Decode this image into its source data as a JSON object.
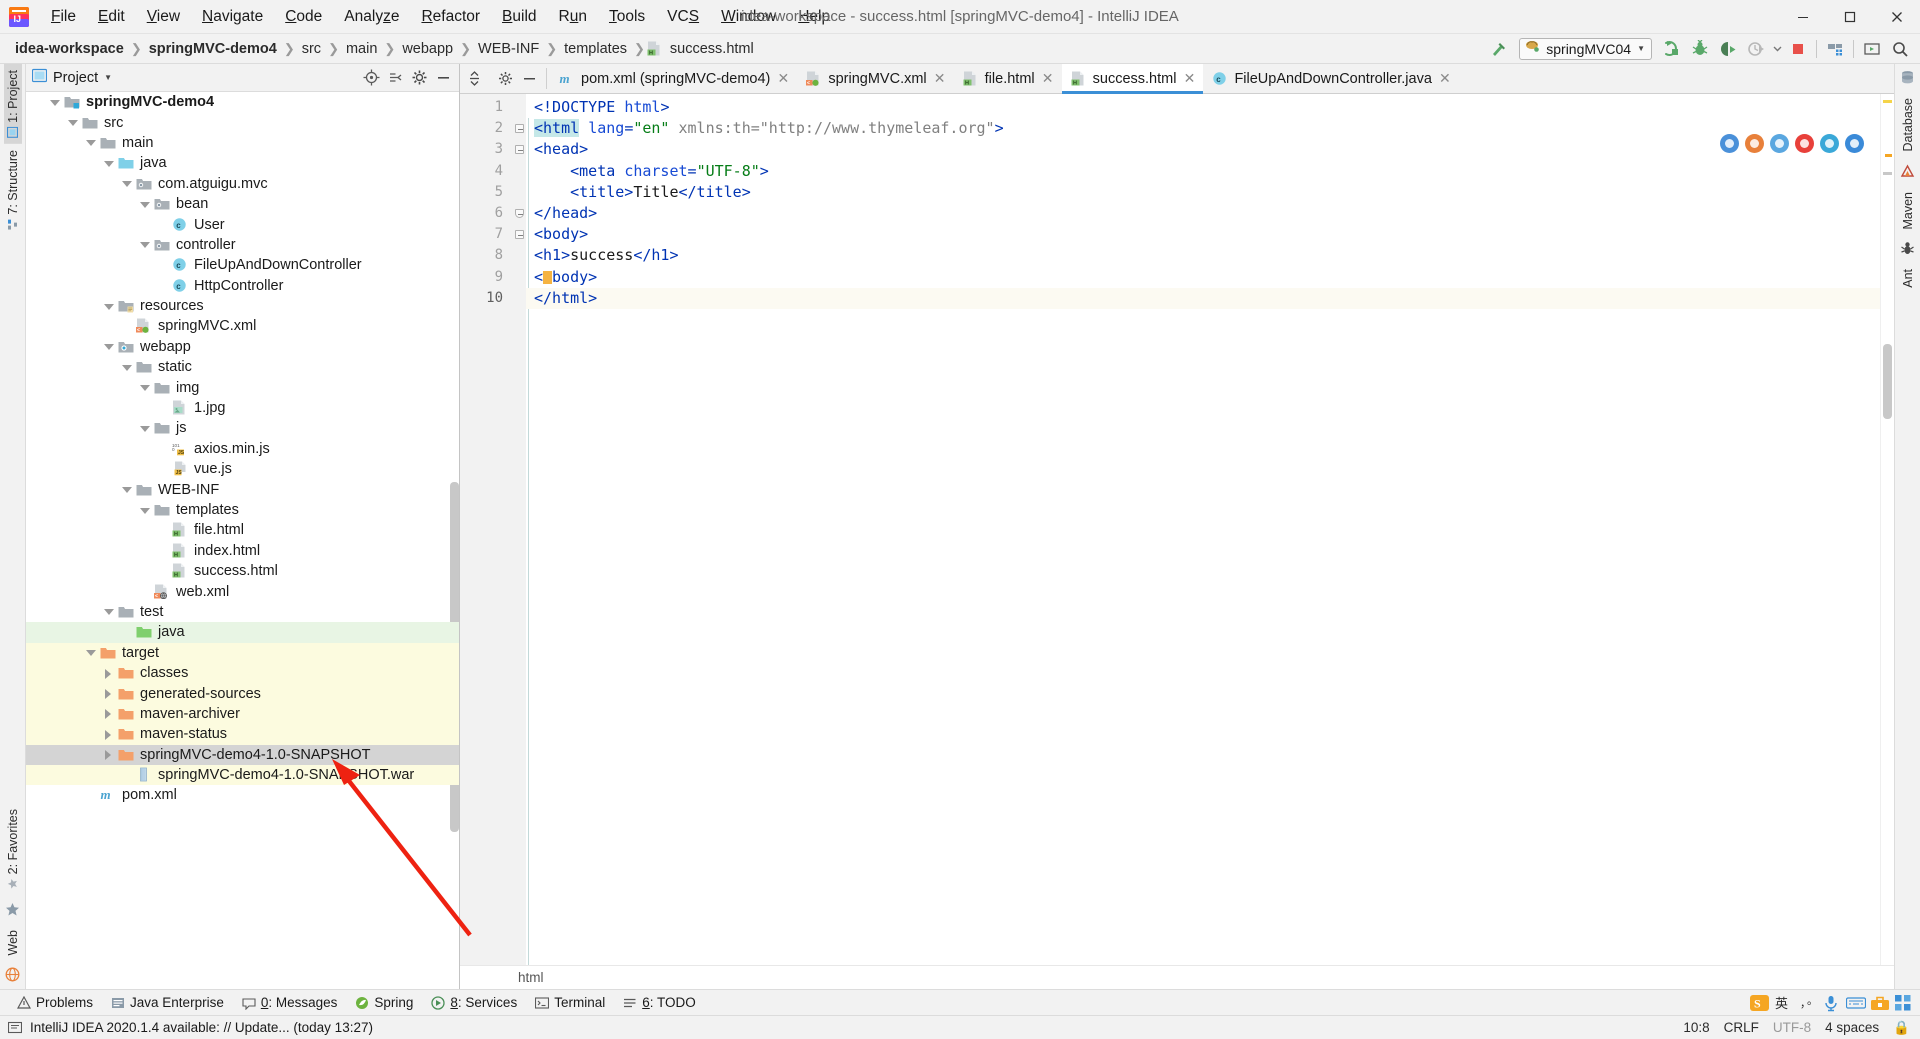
{
  "window": {
    "title": "idea-workspace - success.html [springMVC-demo4] - IntelliJ IDEA",
    "app_icon": "intellij-idea-logo",
    "minimize": "—",
    "maximize": "❐",
    "close": "✕"
  },
  "menubar": [
    {
      "label": "File",
      "mnemonic": "F"
    },
    {
      "label": "Edit",
      "mnemonic": "E"
    },
    {
      "label": "View",
      "mnemonic": "V"
    },
    {
      "label": "Navigate",
      "mnemonic": "N"
    },
    {
      "label": "Code",
      "mnemonic": "C"
    },
    {
      "label": "Analyze",
      "mnemonic": "z"
    },
    {
      "label": "Refactor",
      "mnemonic": "R"
    },
    {
      "label": "Build",
      "mnemonic": "B"
    },
    {
      "label": "Run",
      "mnemonic": "u"
    },
    {
      "label": "Tools",
      "mnemonic": "T"
    },
    {
      "label": "VCS",
      "mnemonic": "S"
    },
    {
      "label": "Window",
      "mnemonic": "W"
    },
    {
      "label": "Help",
      "mnemonic": "H"
    }
  ],
  "breadcrumb": {
    "items": [
      {
        "label": "idea-workspace",
        "bold": true,
        "icon": ""
      },
      {
        "label": "springMVC-demo4",
        "bold": true,
        "icon": ""
      },
      {
        "label": "src",
        "bold": false,
        "icon": ""
      },
      {
        "label": "main",
        "bold": false,
        "icon": ""
      },
      {
        "label": "webapp",
        "bold": false,
        "icon": ""
      },
      {
        "label": "WEB-INF",
        "bold": false,
        "icon": ""
      },
      {
        "label": "templates",
        "bold": false,
        "icon": ""
      },
      {
        "label": "success.html",
        "bold": false,
        "icon": "html-file-icon"
      }
    ],
    "separator": "❯"
  },
  "main_toolbar": {
    "hammer_icon": "build-hammer-icon",
    "run_config": {
      "label": "springMVC04",
      "icon": "tomcat-icon",
      "chevron": "▼"
    },
    "actions": [
      {
        "name": "run-button",
        "icon": "run-icon",
        "color": "#3cab3c"
      },
      {
        "name": "debug-button",
        "icon": "debug-bug-icon",
        "color": "#3cab3c"
      },
      {
        "name": "run-coverage-button",
        "icon": "run-coverage-icon",
        "color": "#3a8a3a"
      },
      {
        "name": "profiler-button",
        "icon": "profiler-icon",
        "color": "#b8b8b8"
      },
      {
        "name": "stop-button",
        "icon": "stop-square-icon",
        "color": "#e8504a"
      },
      {
        "name": "project-structure-button",
        "icon": "project-structure-icon",
        "color": "#3b8fd6"
      },
      {
        "name": "updates-button",
        "icon": "screen-icon",
        "color": "#3cab3c"
      },
      {
        "name": "search-everywhere-button",
        "icon": "search-icon",
        "color": "#4a4a4a"
      }
    ]
  },
  "left_rail": [
    {
      "label": "1: Project",
      "active": true,
      "icon": "project-icon"
    },
    {
      "label": "7: Structure",
      "active": false,
      "icon": "structure-icon"
    },
    {
      "label": "2: Favorites",
      "active": false,
      "icon": "favorites-star-icon"
    },
    {
      "label": "Web",
      "active": false,
      "icon": "web-icon"
    }
  ],
  "right_rail": [
    {
      "label": "Database",
      "icon": "database-icon"
    },
    {
      "label": "Maven",
      "icon": "maven-icon"
    },
    {
      "label": "Ant",
      "icon": "ant-icon"
    }
  ],
  "project_panel": {
    "title": "Project",
    "chevron": "▼",
    "icon": "project-window-icon",
    "header_actions": [
      {
        "name": "scroll-from-source-button",
        "icon": "target-crosshair-icon"
      },
      {
        "name": "collapse-all-button",
        "icon": "collapse-all-icon"
      },
      {
        "name": "settings-button",
        "icon": "gear-icon"
      },
      {
        "name": "hide-button",
        "icon": "minimize-icon"
      }
    ],
    "tree": [
      {
        "label": "springMVC-demo4",
        "depth": 0,
        "arrow": "down",
        "icon": "module-folder",
        "bold": true,
        "bg": ""
      },
      {
        "label": "src",
        "depth": 1,
        "arrow": "down",
        "icon": "folder-gray",
        "bold": false,
        "bg": ""
      },
      {
        "label": "main",
        "depth": 2,
        "arrow": "down",
        "icon": "folder-gray",
        "bold": false,
        "bg": ""
      },
      {
        "label": "java",
        "depth": 3,
        "arrow": "down",
        "icon": "folder-blue-src",
        "bold": false,
        "bg": ""
      },
      {
        "label": "com.atguigu.mvc",
        "depth": 4,
        "arrow": "down",
        "icon": "package",
        "bold": false,
        "bg": ""
      },
      {
        "label": "bean",
        "depth": 5,
        "arrow": "down",
        "icon": "package",
        "bold": false,
        "bg": ""
      },
      {
        "label": "User",
        "depth": 6,
        "arrow": "none",
        "icon": "java-class",
        "bold": false,
        "bg": ""
      },
      {
        "label": "controller",
        "depth": 5,
        "arrow": "down",
        "icon": "package",
        "bold": false,
        "bg": ""
      },
      {
        "label": "FileUpAndDownController",
        "depth": 6,
        "arrow": "none",
        "icon": "java-class",
        "bold": false,
        "bg": ""
      },
      {
        "label": "HttpController",
        "depth": 6,
        "arrow": "none",
        "icon": "java-class",
        "bold": false,
        "bg": ""
      },
      {
        "label": "resources",
        "depth": 3,
        "arrow": "down",
        "icon": "folder-resources",
        "bold": false,
        "bg": ""
      },
      {
        "label": "springMVC.xml",
        "depth": 4,
        "arrow": "none",
        "icon": "spring-xml",
        "bold": false,
        "bg": ""
      },
      {
        "label": "webapp",
        "depth": 3,
        "arrow": "down",
        "icon": "folder-webapp",
        "bold": false,
        "bg": ""
      },
      {
        "label": "static",
        "depth": 4,
        "arrow": "down",
        "icon": "folder-gray",
        "bold": false,
        "bg": ""
      },
      {
        "label": "img",
        "depth": 5,
        "arrow": "down",
        "icon": "folder-gray",
        "bold": false,
        "bg": ""
      },
      {
        "label": "1.jpg",
        "depth": 6,
        "arrow": "none",
        "icon": "image-file",
        "bold": false,
        "bg": ""
      },
      {
        "label": "js",
        "depth": 5,
        "arrow": "down",
        "icon": "folder-gray",
        "bold": false,
        "bg": ""
      },
      {
        "label": "axios.min.js",
        "depth": 6,
        "arrow": "none",
        "icon": "js-min-file",
        "bold": false,
        "bg": ""
      },
      {
        "label": "vue.js",
        "depth": 6,
        "arrow": "none",
        "icon": "js-file",
        "bold": false,
        "bg": ""
      },
      {
        "label": "WEB-INF",
        "depth": 4,
        "arrow": "down",
        "icon": "folder-gray",
        "bold": false,
        "bg": ""
      },
      {
        "label": "templates",
        "depth": 5,
        "arrow": "down",
        "icon": "folder-gray",
        "bold": false,
        "bg": ""
      },
      {
        "label": "file.html",
        "depth": 6,
        "arrow": "none",
        "icon": "html-file",
        "bold": false,
        "bg": ""
      },
      {
        "label": "index.html",
        "depth": 6,
        "arrow": "none",
        "icon": "html-file",
        "bold": false,
        "bg": ""
      },
      {
        "label": "success.html",
        "depth": 6,
        "arrow": "none",
        "icon": "html-file",
        "bold": false,
        "bg": ""
      },
      {
        "label": "web.xml",
        "depth": 5,
        "arrow": "none",
        "icon": "web-xml",
        "bold": false,
        "bg": ""
      },
      {
        "label": "test",
        "depth": 3,
        "arrow": "down",
        "icon": "folder-gray",
        "bold": false,
        "bg": ""
      },
      {
        "label": "java",
        "depth": 4,
        "arrow": "none",
        "icon": "folder-green-test",
        "bold": false,
        "bg": "green"
      },
      {
        "label": "target",
        "depth": 2,
        "arrow": "down",
        "icon": "folder-orange",
        "bold": false,
        "bg": "yellow"
      },
      {
        "label": "classes",
        "depth": 3,
        "arrow": "right",
        "icon": "folder-orange",
        "bold": false,
        "bg": "yellow"
      },
      {
        "label": "generated-sources",
        "depth": 3,
        "arrow": "right",
        "icon": "folder-orange",
        "bold": false,
        "bg": "yellow"
      },
      {
        "label": "maven-archiver",
        "depth": 3,
        "arrow": "right",
        "icon": "folder-orange",
        "bold": false,
        "bg": "yellow"
      },
      {
        "label": "maven-status",
        "depth": 3,
        "arrow": "right",
        "icon": "folder-orange",
        "bold": false,
        "bg": "yellow"
      },
      {
        "label": "springMVC-demo4-1.0-SNAPSHOT",
        "depth": 3,
        "arrow": "right",
        "icon": "folder-orange",
        "bold": false,
        "bg": "sel"
      },
      {
        "label": "springMVC-demo4-1.0-SNAPSHOT.war",
        "depth": 4,
        "arrow": "none",
        "icon": "war-file",
        "bold": false,
        "bg": "yellow"
      },
      {
        "label": "pom.xml",
        "depth": 2,
        "arrow": "none",
        "icon": "maven-pom",
        "bold": false,
        "bg": ""
      }
    ]
  },
  "editor": {
    "tabstrip_actions": [
      {
        "name": "expand-collapse-button",
        "icon": "vertical-arrows-icon"
      },
      {
        "name": "settings-button",
        "icon": "gear-icon"
      },
      {
        "name": "hide-button",
        "icon": "minimize-icon"
      }
    ],
    "tabs": [
      {
        "label": "pom.xml (springMVC-demo4)",
        "icon": "maven-pom",
        "active": false,
        "close": "✕"
      },
      {
        "label": "springMVC.xml",
        "icon": "spring-xml",
        "active": false,
        "close": "✕"
      },
      {
        "label": "file.html",
        "icon": "html-file",
        "active": false,
        "close": "✕"
      },
      {
        "label": "success.html",
        "icon": "html-file",
        "active": true,
        "close": "✕"
      },
      {
        "label": "FileUpAndDownController.java",
        "icon": "java-class",
        "active": false,
        "close": "✕"
      }
    ],
    "line_numbers": [
      "1",
      "2",
      "3",
      "4",
      "5",
      "6",
      "7",
      "8",
      "9",
      "10"
    ],
    "current_line": 10,
    "lines": [
      {
        "n": 1,
        "tokens": [
          {
            "t": "<!DOCTYPE ",
            "c": "tag"
          },
          {
            "t": "html",
            "c": "attr"
          },
          {
            "t": ">",
            "c": "tag"
          }
        ]
      },
      {
        "n": 2,
        "tokens": [
          {
            "t": "<html",
            "c": "tag-hl"
          },
          {
            "t": " ",
            "c": "txt"
          },
          {
            "t": "lang",
            "c": "attr"
          },
          {
            "t": "=",
            "c": "tag"
          },
          {
            "t": "\"en\"",
            "c": "str"
          },
          {
            "t": " ",
            "c": "txt"
          },
          {
            "t": "xmlns:th",
            "c": "gray"
          },
          {
            "t": "=",
            "c": "gray"
          },
          {
            "t": "\"http://www.thymeleaf.org\"",
            "c": "gray"
          },
          {
            "t": ">",
            "c": "tag"
          }
        ]
      },
      {
        "n": 3,
        "tokens": [
          {
            "t": "<head>",
            "c": "tag"
          }
        ]
      },
      {
        "n": 4,
        "tokens": [
          {
            "t": "    <meta ",
            "c": "tag"
          },
          {
            "t": "charset",
            "c": "attr"
          },
          {
            "t": "=",
            "c": "tag"
          },
          {
            "t": "\"UTF-8\"",
            "c": "str"
          },
          {
            "t": ">",
            "c": "tag"
          }
        ]
      },
      {
        "n": 5,
        "tokens": [
          {
            "t": "    <title>",
            "c": "tag"
          },
          {
            "t": "Title",
            "c": "txt"
          },
          {
            "t": "</title>",
            "c": "tag"
          }
        ]
      },
      {
        "n": 6,
        "tokens": [
          {
            "t": "</head>",
            "c": "tag"
          }
        ]
      },
      {
        "n": 7,
        "tokens": [
          {
            "t": "<body>",
            "c": "tag"
          }
        ]
      },
      {
        "n": 8,
        "tokens": [
          {
            "t": "<h1>",
            "c": "tag"
          },
          {
            "t": "success",
            "c": "txt"
          },
          {
            "t": "</h1>",
            "c": "tag"
          }
        ]
      },
      {
        "n": 9,
        "tokens": [
          {
            "t": "<",
            "c": "tag"
          },
          {
            "t": "█",
            "c": "caret"
          },
          {
            "t": "body>",
            "c": "tag"
          }
        ]
      },
      {
        "n": 10,
        "tokens": [
          {
            "t": "</html>",
            "c": "tag"
          }
        ]
      }
    ],
    "browser_popup": [
      {
        "name": "chrome-icon",
        "color": "#4a90d9"
      },
      {
        "name": "firefox-icon",
        "color": "#e8803a"
      },
      {
        "name": "safari-icon",
        "color": "#5aa7e0"
      },
      {
        "name": "opera-icon",
        "color": "#e8403a"
      },
      {
        "name": "edge-legacy-icon",
        "color": "#3aa8d8"
      },
      {
        "name": "edge-icon",
        "color": "#3a8ad8"
      }
    ],
    "footer_breadcrumb": "html"
  },
  "bottom_bar": {
    "items": [
      {
        "label": "Problems",
        "icon": "warning-triangle-icon",
        "mnemonic": ""
      },
      {
        "label": "Java Enterprise",
        "icon": "java-ee-icon",
        "mnemonic": ""
      },
      {
        "label": "0: Messages",
        "icon": "messages-icon",
        "mnemonic": "0"
      },
      {
        "label": "Spring",
        "icon": "spring-leaf-icon",
        "mnemonic": ""
      },
      {
        "label": "8: Services",
        "icon": "services-icon",
        "mnemonic": "8"
      },
      {
        "label": "Terminal",
        "icon": "terminal-icon",
        "mnemonic": ""
      },
      {
        "label": "6: TODO",
        "icon": "todo-list-icon",
        "mnemonic": "6"
      }
    ],
    "tray": [
      {
        "name": "sogou-ime-icon",
        "color": "#f5a623"
      },
      {
        "name": "ime-chinese-icon",
        "color": "#2b2b2b"
      },
      {
        "name": "ime-punctuation-icon",
        "color": "#2b2b2b"
      },
      {
        "name": "microphone-icon",
        "color": "#3b8fd6"
      },
      {
        "name": "keyboard-icon",
        "color": "#3b8fd6"
      },
      {
        "name": "toolbox-icon",
        "color": "#f5a623"
      },
      {
        "name": "apps-grid-icon",
        "color": "#3b8fd6"
      }
    ]
  },
  "status_bar": {
    "left_icon": "event-log-icon",
    "message": "IntelliJ IDEA 2020.1.4 available: // Update... (today 13:27)",
    "right": [
      {
        "label": "10:8",
        "name": "caret-position"
      },
      {
        "label": "CRLF",
        "name": "line-separator"
      },
      {
        "label": "UTF-8",
        "name": "file-encoding",
        "dim": true
      },
      {
        "label": "4 spaces",
        "name": "indent-size"
      },
      {
        "label": "🔒",
        "name": "lock-icon"
      }
    ]
  },
  "annotation": {
    "arrow_color": "#ee2211",
    "name": "red-pointer-arrow"
  },
  "colors": {
    "accent_blue": "#3b8fd6",
    "tab_active_underline": "#3b8fd6",
    "selected_row": "#d4d4d4",
    "test_source_green": "#e8f5e4",
    "excluded_yellow": "#fcfbdf",
    "tag_blue": "#0033b3",
    "string_green": "#067d17"
  }
}
